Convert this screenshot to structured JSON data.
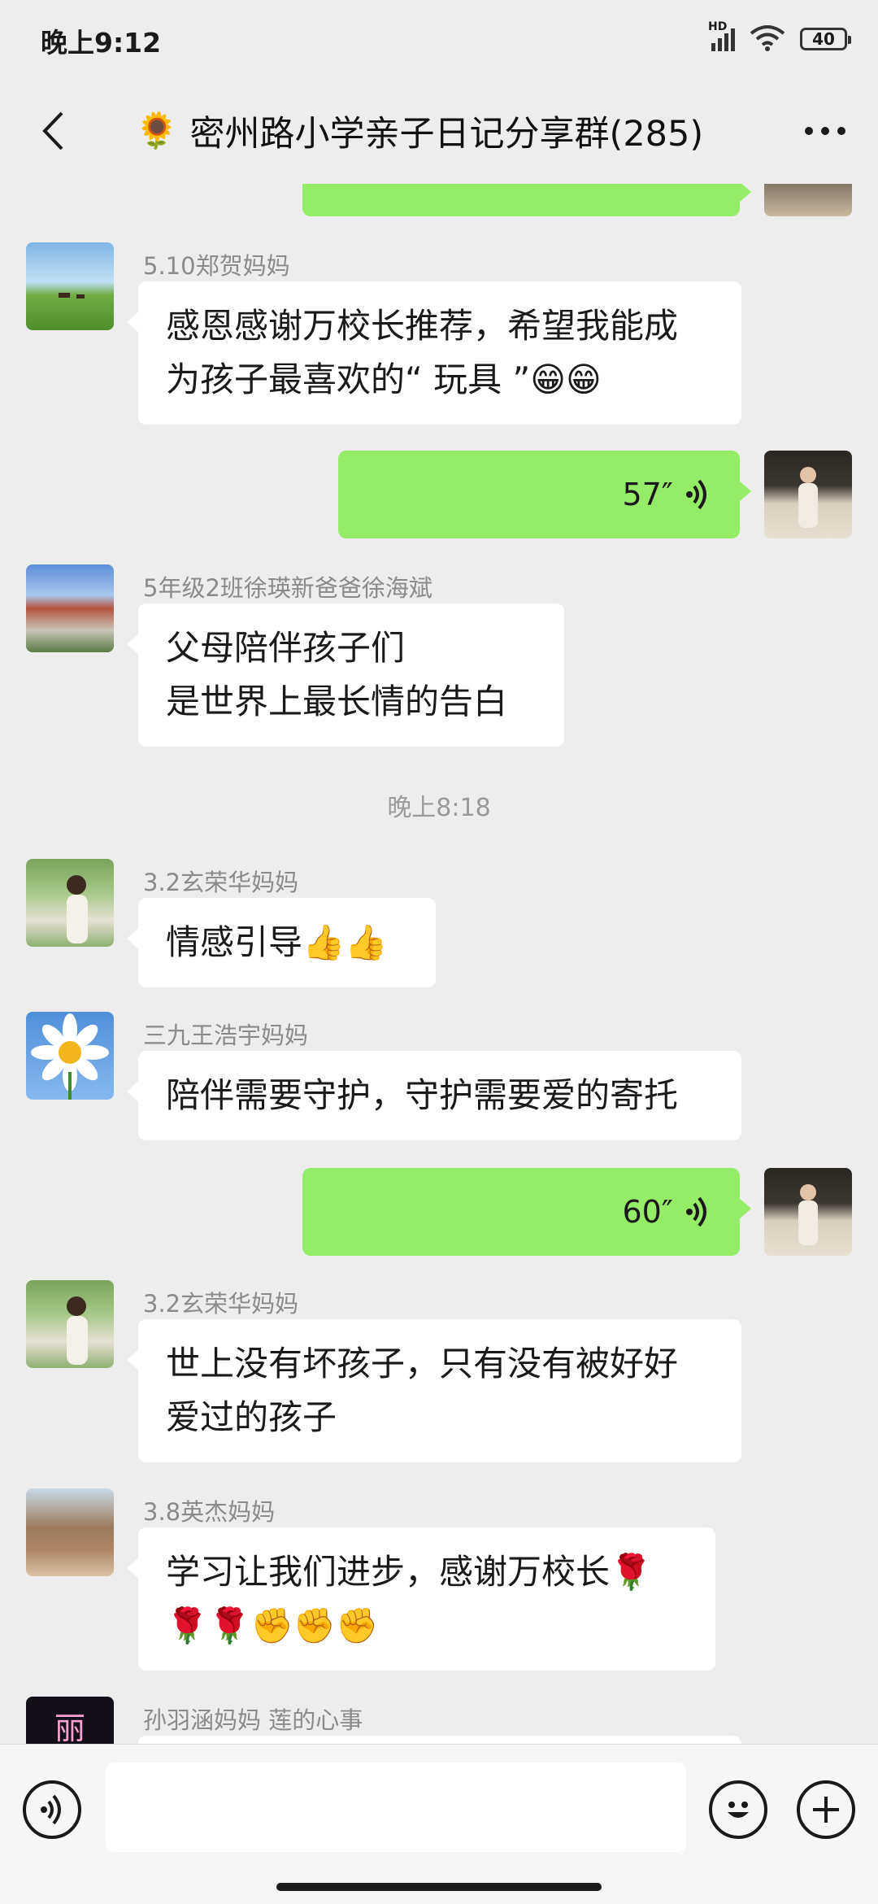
{
  "status": {
    "time": "晚上9:12",
    "network_label": "HD",
    "battery": "40"
  },
  "header": {
    "title": "密州路小学亲子日记分享群(285)",
    "title_icon": "🌻"
  },
  "messages": {
    "m1": {
      "sender": "5.10郑贺妈妈",
      "lines": [
        "感恩感谢万校长推荐，希望我能成",
        "为孩子最喜欢的“ 玩具 ”😁😁"
      ]
    },
    "v1": {
      "duration": "57″"
    },
    "m2": {
      "sender": "5年级2班徐瑛新爸爸徐海斌",
      "lines": [
        "父母陪伴孩子们",
        "是世界上最长情的告白"
      ]
    },
    "time1": "晚上8:18",
    "m3": {
      "sender": "3.2玄荣华妈妈",
      "lines": [
        "情感引导👍👍"
      ]
    },
    "m4": {
      "sender": "三九王浩宇妈妈",
      "lines": [
        "陪伴需要守护，守护需要爱的寄托"
      ]
    },
    "v2": {
      "duration": "60″"
    },
    "m5": {
      "sender": "3.2玄荣华妈妈",
      "lines": [
        "世上没有坏孩子，只有没有被好好",
        "爱过的孩子"
      ]
    },
    "m6": {
      "sender": "3.8英杰妈妈",
      "lines": [
        "学习让我们进步，感谢万校长🌹",
        "🌹🌹✊✊✊"
      ]
    },
    "m7": {
      "sender": "孙羽涵妈妈  莲的心事",
      "avatar_text": "丽"
    }
  },
  "input": {
    "value": ""
  },
  "colors": {
    "background": "#ededed",
    "my_bubble": "#95ec69",
    "other_bubble": "#ffffff"
  },
  "icons": [
    "back-arrow-icon",
    "more-icon",
    "voice-wave-icon",
    "voice-toggle-icon",
    "emoji-icon",
    "plus-icon",
    "signal-icon",
    "wifi-icon",
    "battery-icon"
  ]
}
